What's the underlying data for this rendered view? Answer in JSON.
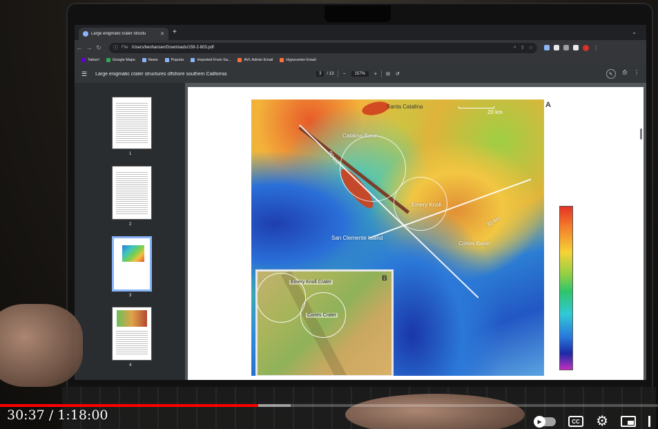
{
  "browser": {
    "tab_title": "Large enigmatic crater structu",
    "address_scheme": "File",
    "address_url": "/Users/benhansen/Downloads/159-2-803.pdf",
    "bookmarks": [
      {
        "label": "Yahoo!",
        "color": "#6001d2"
      },
      {
        "label": "Google Maps",
        "color": "#34a853"
      },
      {
        "label": "News",
        "color": "#8ab4f8"
      },
      {
        "label": "Popular",
        "color": "#8ab4f8"
      },
      {
        "label": "Imported From Sa...",
        "color": "#8ab4f8"
      },
      {
        "label": "AVL Admin Email",
        "color": "#ff7139"
      },
      {
        "label": "Hypocenter Email",
        "color": "#ff7139"
      }
    ]
  },
  "pdf": {
    "title": "Large enigmatic crater structures offshore southern California",
    "page_current": "3",
    "page_total": "/ 13",
    "zoom": "157%",
    "thumbnails": [
      "1",
      "2",
      "3",
      "4"
    ]
  },
  "figure": {
    "panel_a": "A",
    "panel_b": "B",
    "scale_label": "20 km",
    "labels": {
      "santa_catalina": "Santa Catalina",
      "catalina_basin": "Catalina Basin",
      "san_clemente": "San Clemente Island",
      "emery_knoll": "Emery Knoll",
      "cortes_basin": "Cortes Basin",
      "profile_90km": "90 km",
      "profile_30km": "30 km",
      "inset_emery": "Emery Knoll Crater",
      "inset_cortes": "Cortes Crater"
    }
  },
  "video": {
    "time_current": "30:37",
    "time_separator": "/",
    "time_total": "1:18:00",
    "progress_fraction": 0.3924,
    "buffered_fraction": 0.392,
    "cc_label": "CC"
  }
}
